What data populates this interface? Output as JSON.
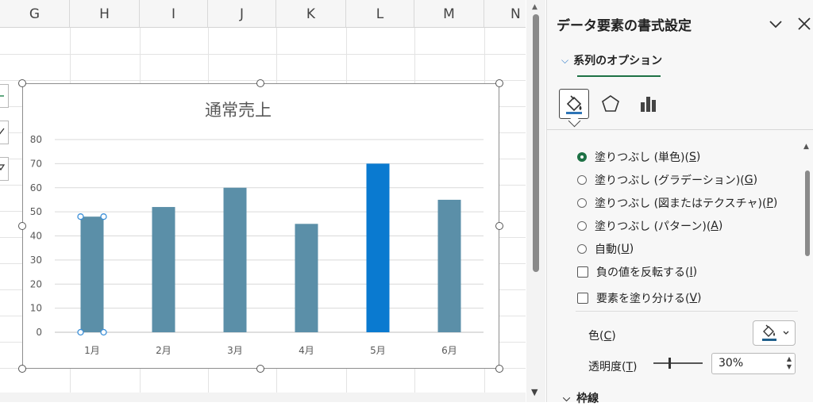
{
  "sheet": {
    "columns": [
      "G",
      "H",
      "I",
      "J",
      "K",
      "L",
      "M",
      "N"
    ]
  },
  "chart_data": {
    "type": "bar",
    "title": "通常売上",
    "categories": [
      "1月",
      "2月",
      "3月",
      "4月",
      "5月",
      "6月"
    ],
    "values": [
      48,
      52,
      60,
      45,
      70,
      55
    ],
    "ylim": [
      0,
      80
    ],
    "yticks": [
      0,
      10,
      20,
      30,
      40,
      50,
      60,
      70,
      80
    ],
    "grid": true,
    "bar_color": "#5b8fa8",
    "highlight_index": 4,
    "highlight_color": "#0a7ad0",
    "selected_index": 0
  },
  "pane": {
    "title": "データ要素の書式設定",
    "collapse_icon": "chevron-down-icon",
    "close_icon": "close-icon",
    "options_tab": "系列のオプション",
    "categories": [
      "fill-line-icon",
      "effects-pentagon-icon",
      "series-options-icon"
    ],
    "fill_options": [
      {
        "pre": "塗りつぶし (単色)(",
        "key": "S",
        "post": ")",
        "checked": true
      },
      {
        "pre": "塗りつぶし (グラデーション)(",
        "key": "G",
        "post": ")",
        "checked": false
      },
      {
        "pre": "塗りつぶし (図またはテクスチャ)(",
        "key": "P",
        "post": ")",
        "checked": false
      },
      {
        "pre": "塗りつぶし (パターン)(",
        "key": "A",
        "post": ")",
        "checked": false
      },
      {
        "pre": "自動(",
        "key": "U",
        "post": ")",
        "checked": false
      }
    ],
    "checks": [
      {
        "pre": "負の値を反転する(",
        "key": "I",
        "post": ")",
        "checked": false
      },
      {
        "pre": "要素を塗り分ける(",
        "key": "V",
        "post": ")",
        "checked": false
      }
    ],
    "color": {
      "pre": "色(",
      "key": "C",
      "post": ")",
      "swatch": "#1f5f8b"
    },
    "transparency": {
      "pre": "透明度(",
      "key": "T",
      "post": ")",
      "value": "30%",
      "level": 0.3
    },
    "line_section": "枠線"
  }
}
